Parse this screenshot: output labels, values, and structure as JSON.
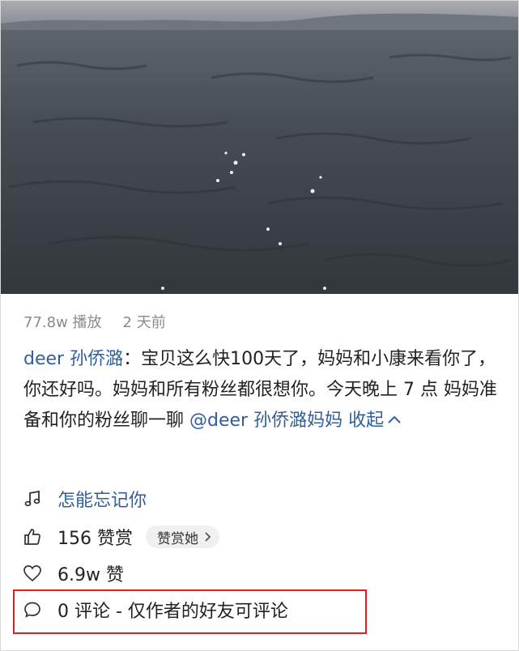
{
  "video": {
    "plays": "77.8w 播放",
    "time_ago": "2 天前"
  },
  "caption": {
    "author": "deer 孙侨潞",
    "separator": "：",
    "text": "宝贝这么快100天了，妈妈和小康来看你了，你还好吗。妈妈和所有粉丝都很想你。今天晚上 7 点 妈妈准备和你的粉丝聊一聊 ",
    "mention": "@deer 孙侨潞妈妈",
    "collapse": " 收起",
    "collapse_icon": "chevron-up-icon"
  },
  "music": {
    "icon": "music-note-icon",
    "title": "怎能忘记你"
  },
  "tips": {
    "icon": "thumbs-up-icon",
    "count_text": "156 赞赏",
    "button_label": "赞赏她",
    "button_icon": "chevron-right-icon"
  },
  "likes": {
    "icon": "heart-icon",
    "count_text": "6.9w 赞"
  },
  "comments": {
    "icon": "comment-bubble-icon",
    "text": "0 评论 - 仅作者的好友可评论"
  },
  "colors": {
    "link": "#2f5e9a",
    "highlight": "#e02020"
  }
}
